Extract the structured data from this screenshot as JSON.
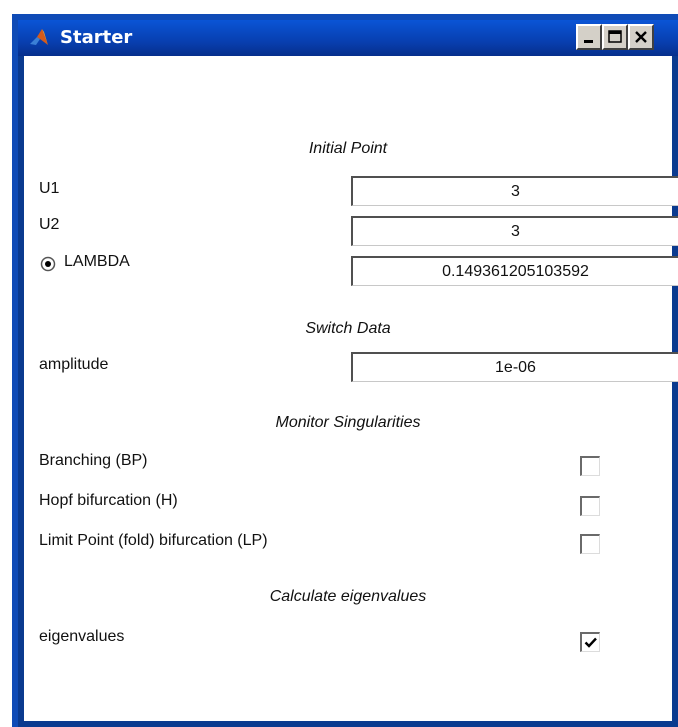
{
  "window": {
    "title": "Starter",
    "app_icon": "matlab-logo-icon",
    "controls": [
      "minimize",
      "maximize",
      "close"
    ]
  },
  "sections": {
    "initial_point": "Initial Point",
    "switch_data": "Switch Data",
    "monitor_singularities": "Monitor Singularities",
    "calculate_eigenvalues": "Calculate eigenvalues"
  },
  "fields": {
    "u1": {
      "label": "U1",
      "value": "3"
    },
    "u2": {
      "label": "U2",
      "value": "3"
    },
    "lambda": {
      "label": "LAMBDA",
      "value": "0.149361205103592",
      "radio_selected": true
    },
    "amplitude": {
      "label": "amplitude",
      "value": "1e-06"
    }
  },
  "monitors": {
    "bp": {
      "label": "Branching (BP)",
      "checked": false
    },
    "h": {
      "label": "Hopf bifurcation (H)",
      "checked": false
    },
    "lp": {
      "label": "Limit Point (fold) bifurcation (LP)",
      "checked": false
    }
  },
  "eigenvalues": {
    "label": "eigenvalues",
    "checked": true
  },
  "colors": {
    "titlebar": "#083fb0",
    "frame": "#0a3a8f",
    "client_bg": "#ffffff"
  }
}
